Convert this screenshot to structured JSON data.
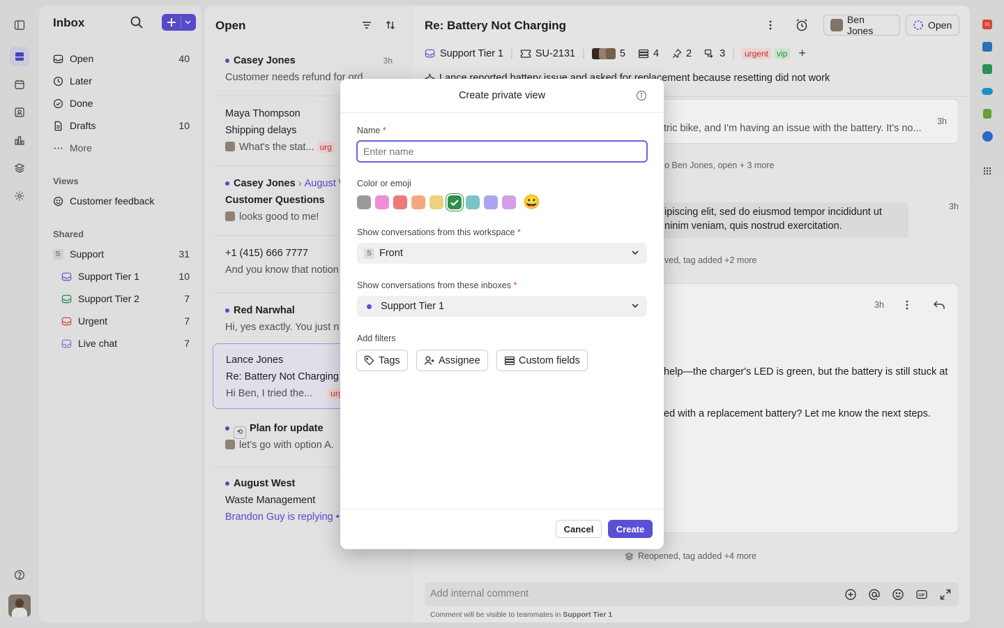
{
  "sidebar": {
    "title": "Inbox",
    "items": [
      {
        "label": "Open",
        "count": "40"
      },
      {
        "label": "Later",
        "count": ""
      },
      {
        "label": "Done",
        "count": ""
      },
      {
        "label": "Drafts",
        "count": "10"
      },
      {
        "label": "More",
        "count": ""
      }
    ],
    "views_header": "Views",
    "views": [
      {
        "label": "Customer feedback"
      }
    ],
    "shared_header": "Shared",
    "shared_root": {
      "label": "Support",
      "badge": "S",
      "count": "31"
    },
    "shared": [
      {
        "label": "Support Tier 1",
        "count": "10",
        "color": "#6f63d9"
      },
      {
        "label": "Support Tier 2",
        "count": "7",
        "color": "#2f9a57"
      },
      {
        "label": "Urgent",
        "count": "7",
        "color": "#d9534f"
      },
      {
        "label": "Live chat",
        "count": "7",
        "color": "#9b7fe0"
      }
    ]
  },
  "list": {
    "title": "Open",
    "conversations": [
      {
        "from": "Casey Jones",
        "line2": "Customer needs refund for ord",
        "time": "3h"
      },
      {
        "from": "Maya Thompson",
        "line2": "Shipping delays",
        "line3": "What's the stat...",
        "tag": "urg"
      },
      {
        "from": "Casey Jones",
        "from2": "August W",
        "line2": "Customer Questions",
        "line3": "looks good to me!"
      },
      {
        "from": "+1 (415) 666 7777",
        "line2": "And you know that notion"
      },
      {
        "from": "Red Narwhal",
        "line2": "Hi, yes exactly. You just n"
      },
      {
        "from": "Lance Jones",
        "line2": "Re: Battery Not Charging",
        "line3": "Hi Ben, I tried the...",
        "tag": "urg"
      },
      {
        "from": "Plan for update",
        "line2": "let's go with option A."
      },
      {
        "from": "August West",
        "line2": "Waste Management",
        "line3": "Brandon Guy is replying •"
      }
    ]
  },
  "main": {
    "subject": "Re: Battery Not Charging",
    "assignee": "Ben Jones",
    "status": "Open",
    "inbox": "Support Tier 1",
    "ticket": "SU-2131",
    "participants": "5",
    "linked": "4",
    "pinned": "2",
    "links": "3",
    "tags": [
      "urgent",
      "vip"
    ],
    "summary": "Lance reported battery issue and asked for replacement because resetting did not work",
    "msg1": "tric bike, and I'm having an issue with the battery. It's no...",
    "msg1_time": "3h",
    "event1": "o Ben Jones, open + 3 more",
    "msg2a": "ipiscing elit, sed do eiusmod tempor incididunt ut",
    "msg2b": "ninim veniam, quis nostrud exercitation.",
    "msg2_time": "3h",
    "event2": "ved, tag added +2 more",
    "msg3_time": "3h",
    "msg3a": "help—the charger's LED is green, but the battery is still stuck at",
    "msg3b": "ed with a replacement battery? Let me know the next steps.",
    "event3": "Reopened, tag added +4 more",
    "comment_placeholder": "Add internal comment",
    "comment_hint_prefix": "Comment will be visible to teammates in ",
    "comment_hint_inbox": "Support Tier 1"
  },
  "modal": {
    "title": "Create private view",
    "name_label": "Name",
    "name_placeholder": "Enter name",
    "color_label": "Color or emoji",
    "colors": [
      "#9a9a9a",
      "#ec8fd6",
      "#ec7a7a",
      "#f3a97f",
      "#ead37b",
      "#2f8f4e",
      "#7cc3c4",
      "#a9a6f0",
      "#d59ee8"
    ],
    "selected_color_index": 5,
    "emoji": "😀",
    "workspace_label": "Show conversations from this workspace",
    "workspace_badge": "S",
    "workspace_value": "Front",
    "inboxes_label": "Show conversations from these inboxes",
    "inbox_value": "Support Tier 1",
    "filters_label": "Add filters",
    "filters": [
      "Tags",
      "Assignee",
      "Custom fields"
    ],
    "cancel": "Cancel",
    "create": "Create"
  }
}
